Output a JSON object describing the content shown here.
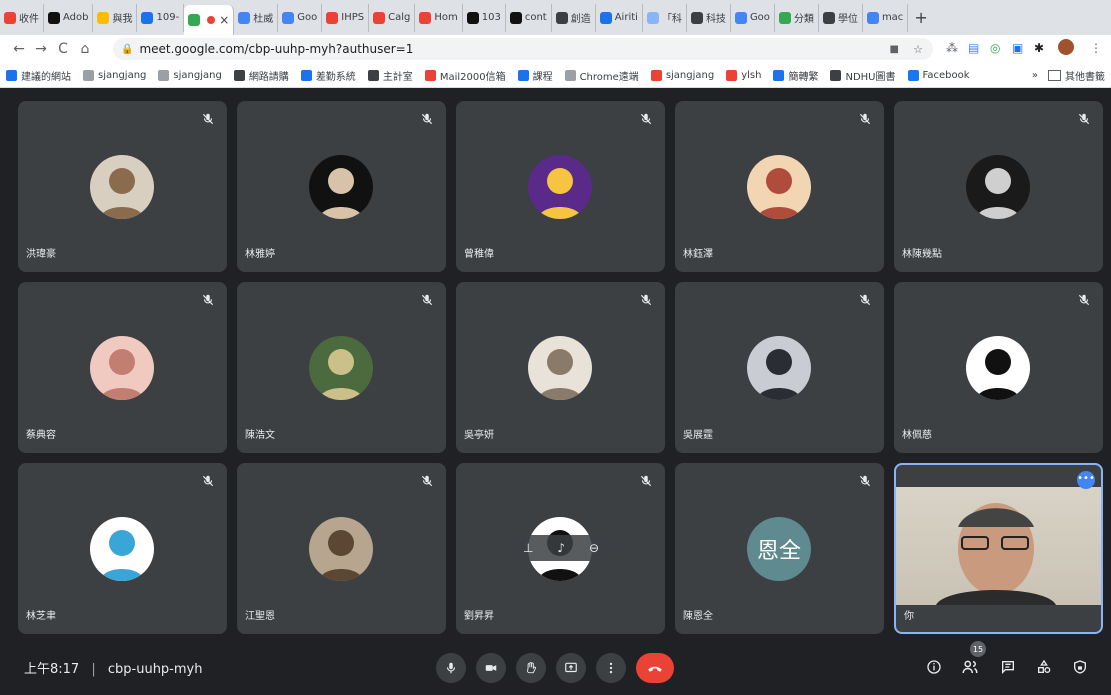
{
  "browser": {
    "tabs": [
      {
        "label": "收件",
        "color": "#ea4335"
      },
      {
        "label": "Adob",
        "color": "#111111"
      },
      {
        "label": "與我",
        "color": "#fbbc04"
      },
      {
        "label": "109-",
        "color": "#1a73e8"
      },
      {
        "label": "",
        "color": "#34a853",
        "active": true
      },
      {
        "label": "杜威",
        "color": "#4285f4"
      },
      {
        "label": "Goo",
        "color": "#4285f4"
      },
      {
        "label": "IHPS",
        "color": "#ea4335"
      },
      {
        "label": "Calg",
        "color": "#ea4335"
      },
      {
        "label": "Hom",
        "color": "#ea4335"
      },
      {
        "label": "103",
        "color": "#111111"
      },
      {
        "label": "cont",
        "color": "#111111"
      },
      {
        "label": "創造",
        "color": "#3c4043"
      },
      {
        "label": "Airiti",
        "color": "#1a73e8"
      },
      {
        "label": "「科",
        "color": "#8ab4f8"
      },
      {
        "label": "科技",
        "color": "#3c4043"
      },
      {
        "label": "Goo",
        "color": "#4285f4"
      },
      {
        "label": "分類",
        "color": "#34a853"
      },
      {
        "label": "學位",
        "color": "#3c4043"
      },
      {
        "label": "mac",
        "color": "#4285f4"
      }
    ],
    "url": "meet.google.com/cbp-uuhp-myh?authuser=1",
    "bookmarks": [
      {
        "label": "建議的網站",
        "color": "#1a73e8"
      },
      {
        "label": "sjangjang",
        "color": "#9aa0a6"
      },
      {
        "label": "sjangjang",
        "color": "#9aa0a6"
      },
      {
        "label": "網路請購",
        "color": "#3c4043"
      },
      {
        "label": "差勤系統",
        "color": "#1a73e8"
      },
      {
        "label": "主計室",
        "color": "#3c4043"
      },
      {
        "label": "Mail2000信箱",
        "color": "#ea4335"
      },
      {
        "label": "課程",
        "color": "#1a73e8"
      },
      {
        "label": "Chrome遠端",
        "color": "#9aa0a6"
      },
      {
        "label": "sjangjang",
        "color": "#ea4335"
      },
      {
        "label": "ylsh",
        "color": "#ea4335"
      },
      {
        "label": "簡轉繁",
        "color": "#1a73e8"
      },
      {
        "label": "NDHU圖書",
        "color": "#3c4043"
      },
      {
        "label": "Facebook",
        "color": "#1877f2"
      }
    ],
    "bookmarks_more": "»",
    "other_bookmarks": "其他書籤"
  },
  "participants": [
    {
      "name": "洪瑋豪",
      "avatar_bg": "#d9cfc1",
      "avatar_fg": "#8a6b4e"
    },
    {
      "name": "林雅婷",
      "avatar_bg": "#111111",
      "avatar_fg": "#d8c2a8"
    },
    {
      "name": "曾稚偉",
      "avatar_bg": "#5a2a8a",
      "avatar_fg": "#f5c542"
    },
    {
      "name": "林鈺澤",
      "avatar_bg": "#f2d6b3",
      "avatar_fg": "#b04c3c"
    },
    {
      "name": "林陳幾點",
      "avatar_bg": "#1a1a1a",
      "avatar_fg": "#cfcfcf"
    },
    {
      "name": "蔡典容",
      "avatar_bg": "#f0c9c0",
      "avatar_fg": "#c27e71"
    },
    {
      "name": "陳浩文",
      "avatar_bg": "#4b6b3f",
      "avatar_fg": "#cbbf8a"
    },
    {
      "name": "吳亭妍",
      "avatar_bg": "#e9e2d8",
      "avatar_fg": "#8a7a6a"
    },
    {
      "name": "吳展霆",
      "avatar_bg": "#c9ccd2",
      "avatar_fg": "#2a2d33"
    },
    {
      "name": "林佩慈",
      "avatar_bg": "#ffffff",
      "avatar_fg": "#111111"
    },
    {
      "name": "林芝聿",
      "avatar_bg": "#ffffff",
      "avatar_fg": "#3aa6d8"
    },
    {
      "name": "江聖恩",
      "avatar_bg": "#b7a58f",
      "avatar_fg": "#5b4733"
    },
    {
      "name": "劉昇昇",
      "avatar_bg": "#ffffff",
      "avatar_fg": "#111111",
      "hover": true
    },
    {
      "name": "陳恩全",
      "initials": "恩全",
      "avatar_bg": "#5f8a8f"
    },
    {
      "name": "你",
      "self": true
    }
  ],
  "meeting": {
    "time": "上午8:17",
    "separator": "|",
    "code": "cbp-uuhp-myh",
    "participant_count": "15"
  },
  "colors": {
    "end_call": "#ea4335",
    "self_border": "#8ab4f8",
    "tile_bg": "#3c4043",
    "page_bg": "#202124"
  }
}
